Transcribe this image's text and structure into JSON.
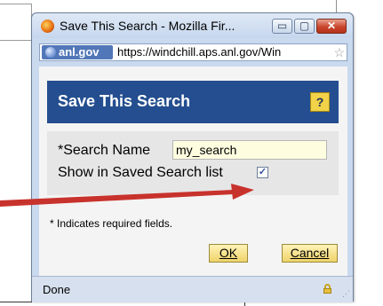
{
  "window": {
    "title": "Save This Search - Mozilla Fir...",
    "controls": {
      "minimize": "▭",
      "maximize": "▢",
      "close": "✕"
    }
  },
  "address": {
    "site": "anl.gov",
    "url": "https://windchill.aps.anl.gov/Win"
  },
  "dialog": {
    "header_title": "Save This Search",
    "help_label": "?",
    "search_name_label": "*Search Name",
    "search_name_value": "my_search",
    "show_saved_label": "Show in Saved Search list",
    "show_saved_checked": true,
    "check_mark": "✓",
    "required_note": "* Indicates required fields.",
    "ok_label": "OK",
    "cancel_label": "Cancel"
  },
  "status": {
    "text": "Done"
  },
  "colors": {
    "header_bg": "#244e8f",
    "button_bg": "#efd36a",
    "annotation_arrow": "#c8322c"
  }
}
